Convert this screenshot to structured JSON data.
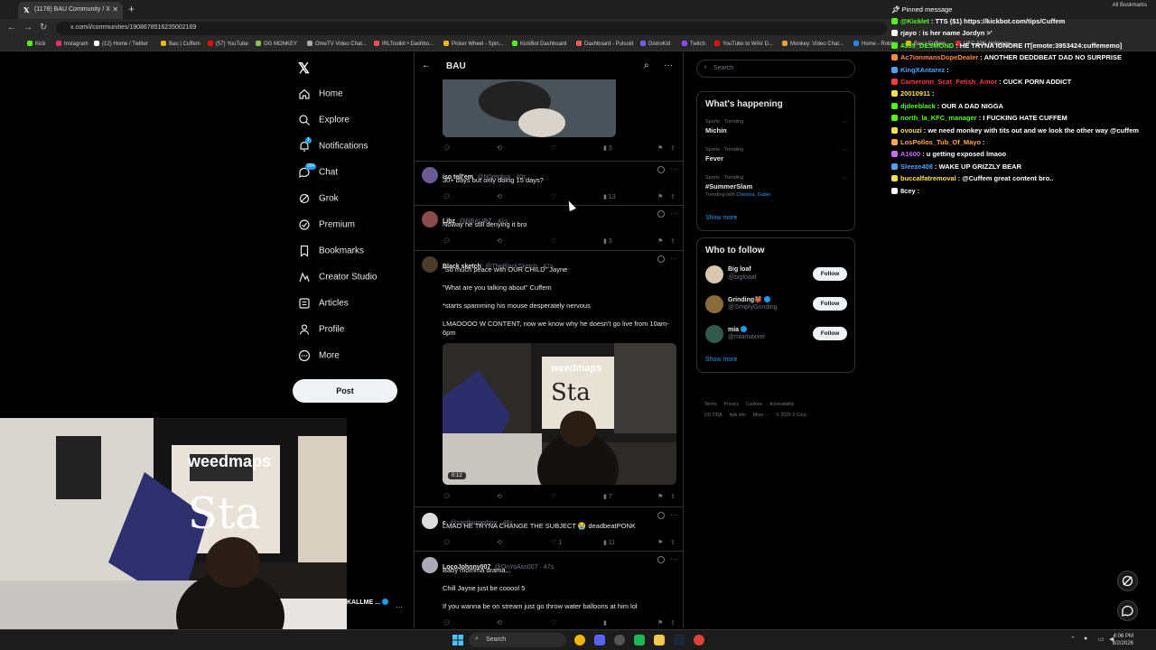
{
  "browser": {
    "tab_title": "(1178) BAU Community / X",
    "url": "x.com/i/communities/1908678516235002169",
    "bookmarks": [
      "Kick",
      "Instagram",
      "(12) Home / Twitter",
      "Bau | Cuffem",
      "(57) YouTube",
      "OG MONKEY",
      "OmeTV Video Chat...",
      "IRLToolkit • Dashbo...",
      "Picker Wheel - Spin...",
      "KickBot Dashboard",
      "Dashboard - Pulsoid",
      "DistroKid",
      "Twitch",
      "YouTube to WAV D...",
      "Monkey: Video Chat...",
      "Home - Roblox",
      "Bau | Cuffem",
      "UFC 326: Holloway..."
    ],
    "all_bookmarks": "All Bookmarks"
  },
  "nav": {
    "items": [
      {
        "label": "Home",
        "icon": "home-icon"
      },
      {
        "label": "Explore",
        "icon": "search-icon"
      },
      {
        "label": "Notifications",
        "icon": "bell-icon",
        "badge": "1"
      },
      {
        "label": "Chat",
        "icon": "chat-icon",
        "badge": "20+"
      },
      {
        "label": "Grok",
        "icon": "grok-icon"
      },
      {
        "label": "Premium",
        "icon": "premium-icon"
      },
      {
        "label": "Bookmarks",
        "icon": "bookmark-icon"
      },
      {
        "label": "Creator Studio",
        "icon": "creator-studio-icon"
      },
      {
        "label": "Articles",
        "icon": "articles-icon"
      },
      {
        "label": "Profile",
        "icon": "profile-icon"
      },
      {
        "label": "More",
        "icon": "more-icon"
      }
    ],
    "post_label": "Post"
  },
  "community": {
    "title": "BAU"
  },
  "tweets": [
    {
      "name": "iso tell'em",
      "handle": "@N0replica · 40s",
      "lines": [
        "30+ days but only doing 15 days?"
      ],
      "views": "13",
      "likes": "",
      "avatar_color": "#6b5b95"
    },
    {
      "name": "Libz",
      "handle": "@NBALIBZ · 41s",
      "lines": [
        "Noway he still denying it bro"
      ],
      "views": "3",
      "likes": "",
      "avatar_color": "#8a4b4b"
    },
    {
      "name": "Black sketch",
      "handle": "@TheBlackSketch · 41s",
      "lines": [
        "\"So much peace with OUR CHILD\" Jayne",
        "",
        "\"What are you talking about\" Cuffem",
        "",
        "*starts spamming his mouse desperately nervous",
        "",
        "LMAOOOO W CONTENT, now we know why he doesn't go live from 10am-",
        "6pm"
      ],
      "views": "7",
      "likes": "",
      "avatar_color": "#4a3b2a",
      "video_duration": "0:12"
    },
    {
      "name": "c",
      "handle": "@captburgerboy · 46s",
      "lines": [
        "LMAO HE TRYNA CHANGE THE SUBJECT 😭 deadbeatPONK"
      ],
      "views": "11",
      "likes": "1",
      "avatar_color": "#ddd"
    },
    {
      "name": "LocoJohnny007",
      "handle": "@OnYoAss007 · 47s",
      "lines": [
        "Baby momma drama...",
        "",
        "Chill Jayne just be cooool 5",
        "",
        "If you wanna be on stream just go throw water balloons at him lol"
      ],
      "views": "",
      "likes": "",
      "avatar_color": "#aab"
    }
  ],
  "top_post": {
    "views": "3"
  },
  "right": {
    "search_placeholder": "Search",
    "happening_title": "What's happening",
    "trends": [
      {
        "meta": "Sports · Trending",
        "name": "Michin",
        "sub": ""
      },
      {
        "meta": "Sports · Trending",
        "name": "Fever",
        "sub": ""
      },
      {
        "meta": "Sports · Trending",
        "name": "#SummerSlam",
        "sub": "Trending with",
        "with": "Chelsea, Gable"
      }
    ],
    "show_more": "Show more",
    "follow_title": "Who to follow",
    "follow": [
      {
        "name": "Big loaf",
        "handle": "@bigloaaf",
        "avatar_color": "#d9c7b0"
      },
      {
        "name": "Grinding👹",
        "handle": "@SimplyGrinding",
        "avatar_color": "#8c6b3a"
      },
      {
        "name": "mia",
        "handle": "@miamaxxer",
        "avatar_color": "#2f5a4d"
      }
    ],
    "follow_label": "Follow",
    "footer": [
      "Terms",
      "Privacy",
      "Cookies",
      "Accessibility",
      "US TIDA",
      "Ads info",
      "More ···",
      "© 2026 X Corp."
    ]
  },
  "chat": {
    "pinned": "Pinned message",
    "messages": [
      {
        "user": "@Kicklet",
        "msg": ": TTS ($1) https://kickbot.com/tips/Cuffem",
        "color": "#53fc18"
      },
      {
        "user": "rjayo",
        "msg": ": is her name Jordyn >'",
        "color": "#ffffff"
      },
      {
        "user": "4355_DESMOND",
        "msg": ": HE TRYNA IGNORE IT[emote:3953424:cuffememo]",
        "color": "#53fc18"
      },
      {
        "user": "Ac7ionmansDopeDealer",
        "msg": ": ANOTHER DEDDBEAT DAD NO SURPRISE",
        "color": "#ff8a3d"
      },
      {
        "user": "KingXAntarez",
        "msg": ": ",
        "color": "#4da3ff"
      },
      {
        "user": "Cameronn_Scat_Fetish_Amor",
        "msg": ": CUCK PORN ADDICT",
        "color": "#ff3b3b"
      },
      {
        "user": "20010911",
        "msg": ": ",
        "color": "#ffe14d"
      },
      {
        "user": "djdeeblack",
        "msg": ": OUR A DAD NIGGA",
        "color": "#53fc18"
      },
      {
        "user": "north_la_KFC_manager",
        "msg": ": I FUCKING HATE CUFFEM",
        "color": "#53fc18"
      },
      {
        "user": "ovouzi",
        "msg": ": we need monkey with tits out and we look the other way @cuffem",
        "color": "#ffe14d"
      },
      {
        "user": "LosPollos_Tub_Of_Mayo",
        "msg": ": ",
        "color": "#ffa64d"
      },
      {
        "user": "A1600",
        "msg": ": u getting exposed lmaoo",
        "color": "#c86bff"
      },
      {
        "user": "Sleeze408",
        "msg": ": WAKE UP GRIZZLY BEAR",
        "color": "#4da3ff"
      },
      {
        "user": "buccalfatremoval",
        "msg": ": @Cuffem great content bro..",
        "color": "#ffe14d"
      },
      {
        "user": "8cey",
        "msg": ": ",
        "color": "#ffffff"
      }
    ]
  },
  "stream": {
    "name": "KALLME ..."
  },
  "taskbar": {
    "search": "Search",
    "time": "4:06 PM",
    "date": "8/2/2026"
  }
}
